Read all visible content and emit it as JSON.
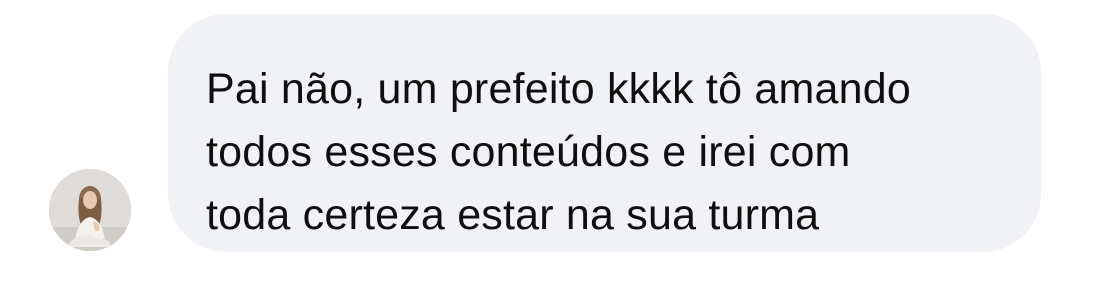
{
  "message": {
    "sender_avatar_icon": "profile-photo",
    "text": "Pai não, um prefeito kkkk tô amando\ntodos esses conteúdos e irei com\ntoda certeza estar na sua turma"
  },
  "colors": {
    "bubble_background": "#f1f2f6",
    "text": "#0f0f0f",
    "page_background": "#ffffff"
  }
}
